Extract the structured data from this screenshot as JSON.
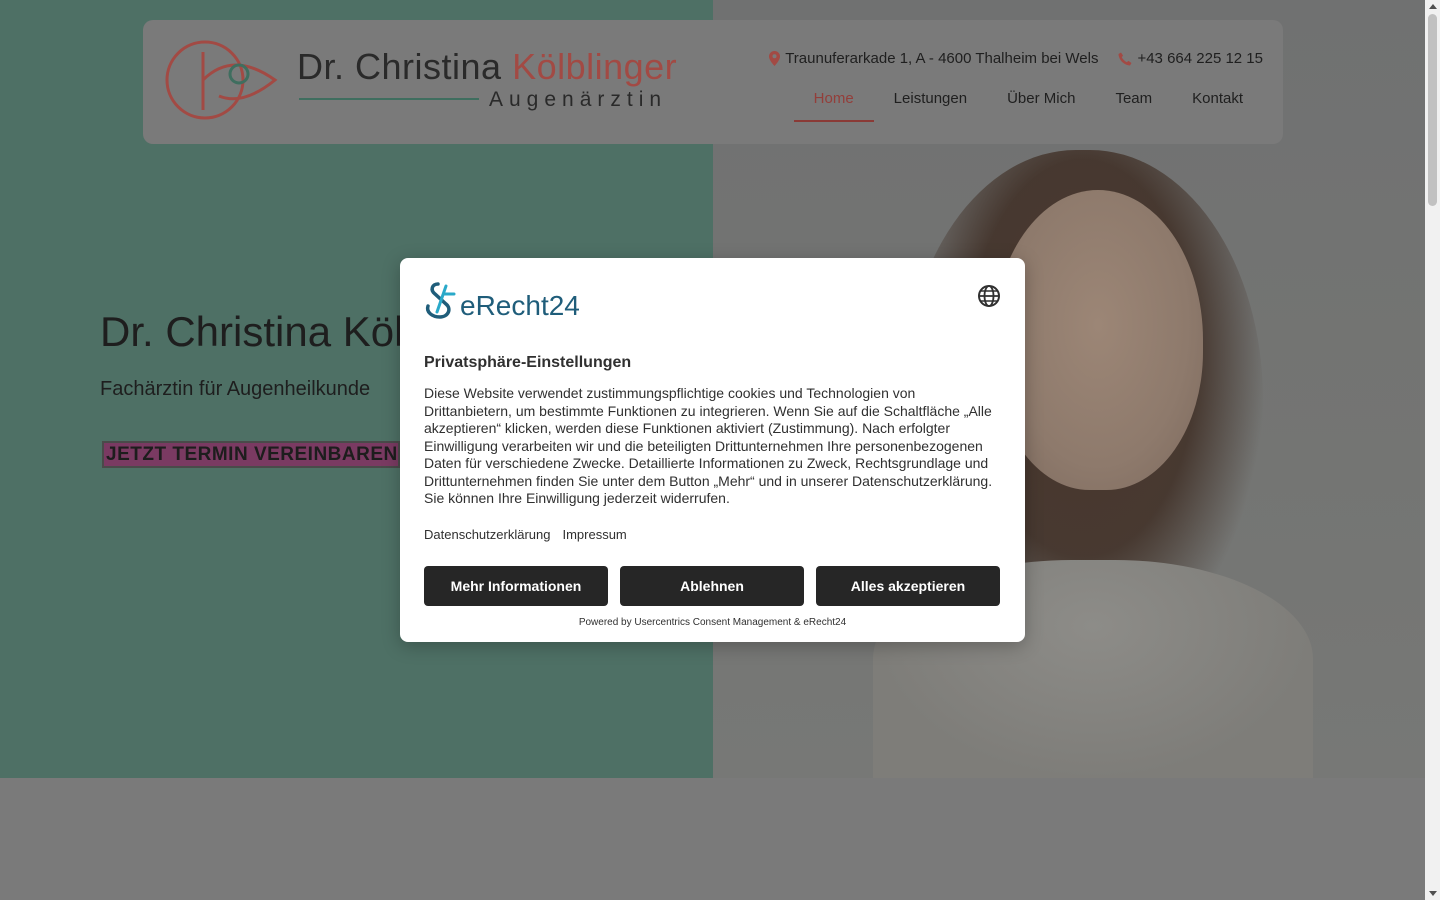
{
  "header": {
    "logo_name_part1": "Dr. Christina ",
    "logo_name_part2": "Kölblinger",
    "logo_subtitle": "Augenärztin",
    "address": "Traunuferarkade 1, A - 4600 Thalheim bei Wels",
    "phone": "+43 664 225 12 15"
  },
  "nav": {
    "items": [
      {
        "label": "Home",
        "active": true
      },
      {
        "label": "Leistungen"
      },
      {
        "label": "Über Mich"
      },
      {
        "label": "Team"
      },
      {
        "label": "Kontakt"
      }
    ]
  },
  "hero": {
    "title": "Dr. Christina Kölblinger",
    "subtitle": "Fachärztin für Augenheilkunde",
    "cta": "JETZT TERMIN VEREINBAREN"
  },
  "consent": {
    "brand": "eRecht24",
    "title": "Privatsphäre-Einstellungen",
    "body": "Diese Website verwendet zustimmungspflichtige cookies und Technologien von Drittanbietern, um bestimmte Funktionen zu integrieren. Wenn Sie auf die Schaltfläche „Alle akzeptieren“ klicken, werden diese Funktionen aktiviert (Zustimmung). Nach erfolgter Einwilligung verarbeiten wir und die beteiligten Drittunternehmen Ihre personenbezogenen Daten für verschiedene Zwecke. Detaillierte Informationen zu Zweck, Rechtsgrundlage und Drittunternehmen finden Sie unter dem Button „Mehr“ und in unserer Datenschutzerklärung. Sie können Ihre Einwilligung jederzeit widerrufen.",
    "link_privacy": "Datenschutzerklärung",
    "link_imprint": "Impressum",
    "btn_more": "Mehr Informationen",
    "btn_decline": "Ablehnen",
    "btn_accept": "Alles akzeptieren",
    "powered_by": "Powered by Usercentrics Consent Management & eRecht24"
  },
  "icons": {
    "address": "map-pin-icon",
    "phone": "phone-icon",
    "language": "globe-icon"
  },
  "colors": {
    "accent": "#a24a44",
    "hero_left": "#4e7065",
    "button_dark": "#262626",
    "cta_bg": "#7a3a62"
  }
}
